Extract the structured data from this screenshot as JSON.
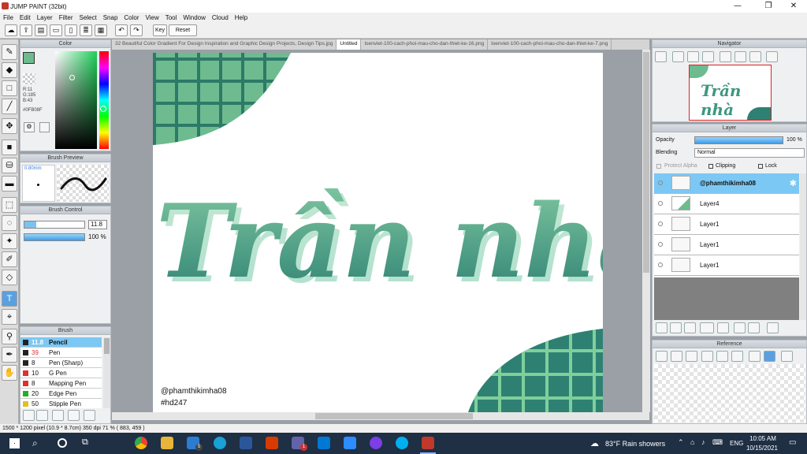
{
  "window": {
    "title": "JUMP PAINT (32bit)",
    "min": "—",
    "max": "❐",
    "close": "✕"
  },
  "menu": [
    "File",
    "Edit",
    "Layer",
    "Filter",
    "Select",
    "Snap",
    "Color",
    "View",
    "Tool",
    "Window",
    "Cloud",
    "Help"
  ],
  "toolbar": {
    "key_label": "Key",
    "reset_label": "Reset"
  },
  "color_panel": {
    "title": "Color",
    "r": "R:11",
    "g": "G:185",
    "b": "B:43",
    "hex": "#0FB08F",
    "fg_color": "#6dbb8f"
  },
  "brush_preview": {
    "title": "Brush Preview",
    "size": "0.80mm"
  },
  "brush_control": {
    "title": "Brush Control",
    "size_value": "11.8",
    "opacity_value": "100 %"
  },
  "brush_panel": {
    "title": "Brush",
    "items": [
      {
        "size": "11.8",
        "name": "Pencil",
        "color": "#222222",
        "selected": true
      },
      {
        "size": "39",
        "name": "Pen",
        "color": "#222222"
      },
      {
        "size": "8",
        "name": "Pen (Sharp)",
        "color": "#222222"
      },
      {
        "size": "10",
        "name": "G Pen",
        "color": "#e03030"
      },
      {
        "size": "8",
        "name": "Mapping Pen",
        "color": "#e03030"
      },
      {
        "size": "20",
        "name": "Edge Pen",
        "color": "#20b020"
      },
      {
        "size": "50",
        "name": "Stipple Pen",
        "color": "#e0c020"
      }
    ]
  },
  "tabs": [
    "32 Beautiful Color Gradient For Design Inspiration and Graphic Design Projects, Design Tips.jpg",
    "Untitled",
    "loenviet-100-cach-phoi-mau-cho-dan-thiet-ke-16.png",
    "loenviet-100-cach-phoi-mau-cho-dan-thiet-ke-7.png"
  ],
  "canvas": {
    "title_text": "Trần nhà",
    "handle": "@phamthikimha08",
    "hashtag": "#hd247"
  },
  "navigator": {
    "title": "Navigator"
  },
  "layer_panel": {
    "title": "Layer",
    "opacity_label": "Opacity",
    "opacity_value": "100 %",
    "blending_label": "Blending",
    "blending_value": "Normal",
    "protect_alpha": "Protect Alpha",
    "clipping": "Clipping",
    "lock": "Lock",
    "layers": [
      "@phamthikimha08",
      "Layer4",
      "Layer1",
      "Layer1",
      "Layer1"
    ]
  },
  "reference": {
    "title": "Reference"
  },
  "status": "1500 * 1200 pixel  (10.9 * 8.7cm)  350 dpi  71 %  ( 883, 459 )",
  "taskbar": {
    "weather": "83°F  Rain showers",
    "lang": "ENG",
    "time": "10:05 AM",
    "date": "10/15/2021",
    "mail_badge": "5",
    "teams_badge": "1"
  }
}
